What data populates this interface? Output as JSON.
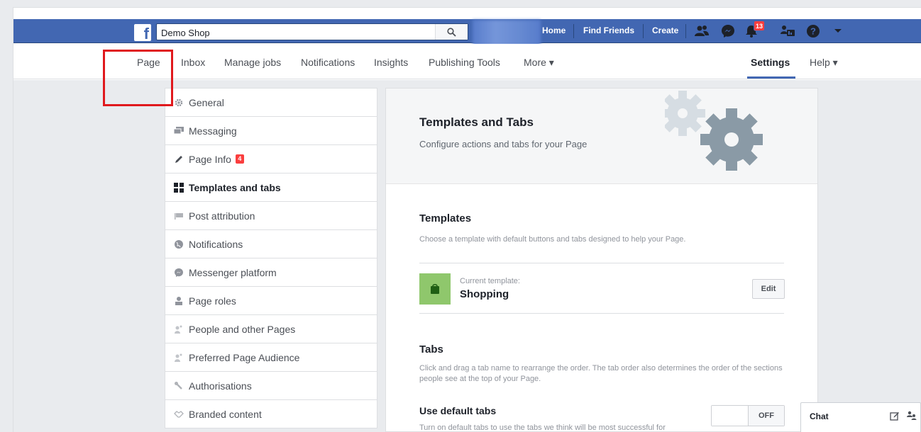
{
  "topbar": {
    "logo_glyph": "f",
    "search_value": "Demo Shop",
    "links": {
      "home": "Home",
      "find_friends": "Find Friends",
      "create": "Create"
    },
    "notification_count": "13",
    "icons": [
      "friend-requests-icon",
      "messenger-icon",
      "notifications-icon",
      "quick-help-icon",
      "help-icon",
      "account-menu-icon"
    ],
    "color": "#4267b2"
  },
  "page_nav": {
    "items": [
      "Page",
      "Inbox",
      "Manage jobs",
      "Notifications",
      "Insights",
      "Publishing Tools",
      "More ▾"
    ],
    "settings": "Settings",
    "help": "Help ▾",
    "active": "Settings"
  },
  "sidebar": {
    "items": [
      {
        "label": "General",
        "icon": "gear-icon"
      },
      {
        "label": "Messaging",
        "icon": "messaging-icon"
      },
      {
        "label": "Page Info",
        "icon": "pencil-icon",
        "badge": "4"
      },
      {
        "label": "Templates and tabs",
        "icon": "grid-icon",
        "active": true
      },
      {
        "label": "Post attribution",
        "icon": "flag-icon"
      },
      {
        "label": "Notifications",
        "icon": "globe-icon"
      },
      {
        "label": "Messenger platform",
        "icon": "messenger-icon"
      },
      {
        "label": "Page roles",
        "icon": "person-icon"
      },
      {
        "label": "People and other Pages",
        "icon": "people-icon"
      },
      {
        "label": "Preferred Page Audience",
        "icon": "audience-icon"
      },
      {
        "label": "Authorisations",
        "icon": "wrench-icon"
      },
      {
        "label": "Branded content",
        "icon": "handshake-icon"
      }
    ]
  },
  "main": {
    "title": "Templates and Tabs",
    "subtitle": "Configure actions and tabs for your Page",
    "templates": {
      "title": "Templates",
      "description": "Choose a template with default buttons and tabs designed to help your Page.",
      "current_label": "Current template:",
      "current_value": "Shopping",
      "edit_label": "Edit",
      "icon_color": "#8fc76c"
    },
    "tabs": {
      "title": "Tabs",
      "description": "Click and drag a tab name to rearrange the order. The tab order also determines the order of the sections people see at the top of your Page.",
      "default_tabs_title": "Use default tabs",
      "default_tabs_desc": "Turn on default tabs to use the tabs we think will be most successful for",
      "toggle_state": "OFF"
    }
  },
  "chat": {
    "label": "Chat"
  }
}
